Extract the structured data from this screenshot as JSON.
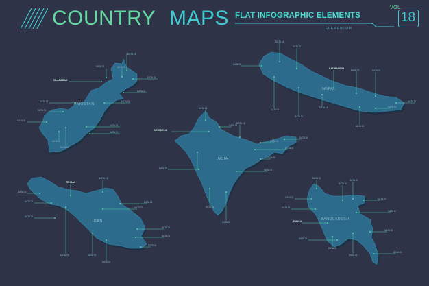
{
  "header": {
    "title_country": "COUNTRY",
    "title_maps": "MAPS",
    "subtitle": "FLAT INFOGRAPHIC ELEMENTS",
    "brand": "ELEMENTUM",
    "vol_label": "VOL.",
    "vol_number": "18"
  },
  "countries": {
    "pakistan": {
      "name": "PAKISTAN",
      "capital": "ISLAMABAD"
    },
    "nepal": {
      "name": "NEPAL",
      "capital": "KATHMANDU"
    },
    "india": {
      "name": "INDIA",
      "capital": "NEW DELHI"
    },
    "iran": {
      "name": "IRAN",
      "capital": "TEHRAN"
    },
    "bangladesh": {
      "name": "BANGLADESH",
      "capital": "DHAKA"
    }
  },
  "data_tag": "DATA 01",
  "colors": {
    "background": "#2e3347",
    "country_fill": "#2c6b8c",
    "title_green": "#63d9a2",
    "title_cyan": "#3ec9cf",
    "leader_line": "#4fd3a8"
  }
}
